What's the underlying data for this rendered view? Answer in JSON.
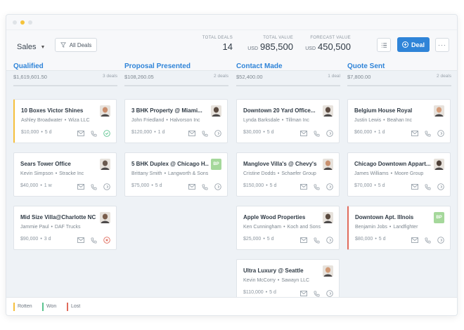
{
  "toolbar": {
    "pipeline": "Sales",
    "filter_label": "All Deals",
    "deal_button": "Deal",
    "stats": [
      {
        "label": "TOTAL DEALS",
        "currency": "",
        "value": "14"
      },
      {
        "label": "TOTAL VALUE",
        "currency": "USD",
        "value": "985,500"
      },
      {
        "label": "FORECAST VALUE",
        "currency": "USD",
        "value": "450,500"
      }
    ]
  },
  "columns": [
    {
      "title": "Qualified",
      "value": "$1,619,601.50",
      "count": "3 deals"
    },
    {
      "title": "Proposal Presented",
      "value": "$108,260.05",
      "count": "2 deals"
    },
    {
      "title": "Contact Made",
      "value": "$52,400.00",
      "count": "1 deal"
    },
    {
      "title": "Quote Sent",
      "value": "$7,800.00",
      "count": "2 deals"
    }
  ],
  "cards": [
    {
      "title": "10 Boxes Victor Shines",
      "person": "Ashley Broadwater",
      "org": "Wiza LLC",
      "value": "$10,000",
      "age": "5 d",
      "status": "rotten",
      "action": "done",
      "avatar": "face",
      "avatar_color": "#c98d6c"
    },
    {
      "title": "Sears Tower Office",
      "person": "Kevin Simpson",
      "org": "Stracke Inc",
      "value": "$40,000",
      "age": "1 w",
      "status": "",
      "action": "pending",
      "avatar": "face",
      "avatar_color": "#6a5a4f"
    },
    {
      "title": "Mid Size Villa@Charlotte NC",
      "person": "Jammie Paul",
      "org": "DAF Trucks",
      "value": "$90,000",
      "age": "3 d",
      "status": "",
      "action": "overdue",
      "avatar": "face",
      "avatar_color": "#7b5e4c"
    },
    {
      "title": "3 BHK Property @ Miami...",
      "person": "John Friedland",
      "org": "Halvorson Inc",
      "value": "$120,000",
      "age": "1 d",
      "status": "",
      "action": "pending",
      "avatar": "face",
      "avatar_color": "#5a4a40"
    },
    {
      "title": "5 BHK Duplex @ Chicago H...",
      "person": "Brittany Smith",
      "org": "Langworth & Sons",
      "value": "$75,000",
      "age": "5 d",
      "status": "",
      "action": "pending",
      "avatar": "BP",
      "avatar_color": "#a5d89b"
    },
    {
      "title": "Downtown 20 Yard Office...",
      "person": "Lynda Barksdale",
      "org": "Tillman Inc",
      "value": "$30,000",
      "age": "5 d",
      "status": "",
      "action": "pending",
      "avatar": "face",
      "avatar_color": "#5d4c42"
    },
    {
      "title": "Manglove Villa's @ Chevy's",
      "person": "Cristine Dodds",
      "org": "Schaefer Group",
      "value": "$150,000",
      "age": "5 d",
      "status": "",
      "action": "pending",
      "avatar": "face",
      "avatar_color": "#c9906e"
    },
    {
      "title": "Apple Wood Properties",
      "person": "Ken Cunningham",
      "org": "Koch and Sons",
      "value": "$25,000",
      "age": "5 d",
      "status": "",
      "action": "pending",
      "avatar": "face",
      "avatar_color": "#5a4a3f"
    },
    {
      "title": "Ultra Luxury @ Seattle",
      "person": "Kevin McCorry",
      "org": "Sawayn LLC",
      "value": "$110,000",
      "age": "5 d",
      "status": "",
      "action": "pending",
      "avatar": "face",
      "avatar_color": "#d19a76"
    },
    {
      "title": "Belgium House Royal",
      "person": "Justin Lewis",
      "org": "Beahan Inc",
      "value": "$60,000",
      "age": "1 d",
      "status": "",
      "action": "pending",
      "avatar": "face",
      "avatar_color": "#d49c7a"
    },
    {
      "title": "Chicago Downtown Appart...",
      "person": "James Williams",
      "org": "Moore Group",
      "value": "$70,000",
      "age": "5 d",
      "status": "",
      "action": "pending",
      "avatar": "face",
      "avatar_color": "#4e4038"
    },
    {
      "title": "Downtown Apt. Illnois",
      "person": "Benjamin Jobs",
      "org": "Landfighter",
      "value": "$80,000",
      "age": "5 d",
      "status": "lost",
      "action": "pending",
      "avatar": "BP",
      "avatar_color": "#a5d89b"
    }
  ],
  "legend": [
    {
      "label": "Rotten",
      "color": "#f5bf3c"
    },
    {
      "label": "Won",
      "color": "#5bc38f"
    },
    {
      "label": "Lost",
      "color": "#e06b5c"
    }
  ],
  "colors": {
    "accent": "#2f84d8",
    "done": "#5bc38f",
    "overdue": "#e06b5c"
  }
}
